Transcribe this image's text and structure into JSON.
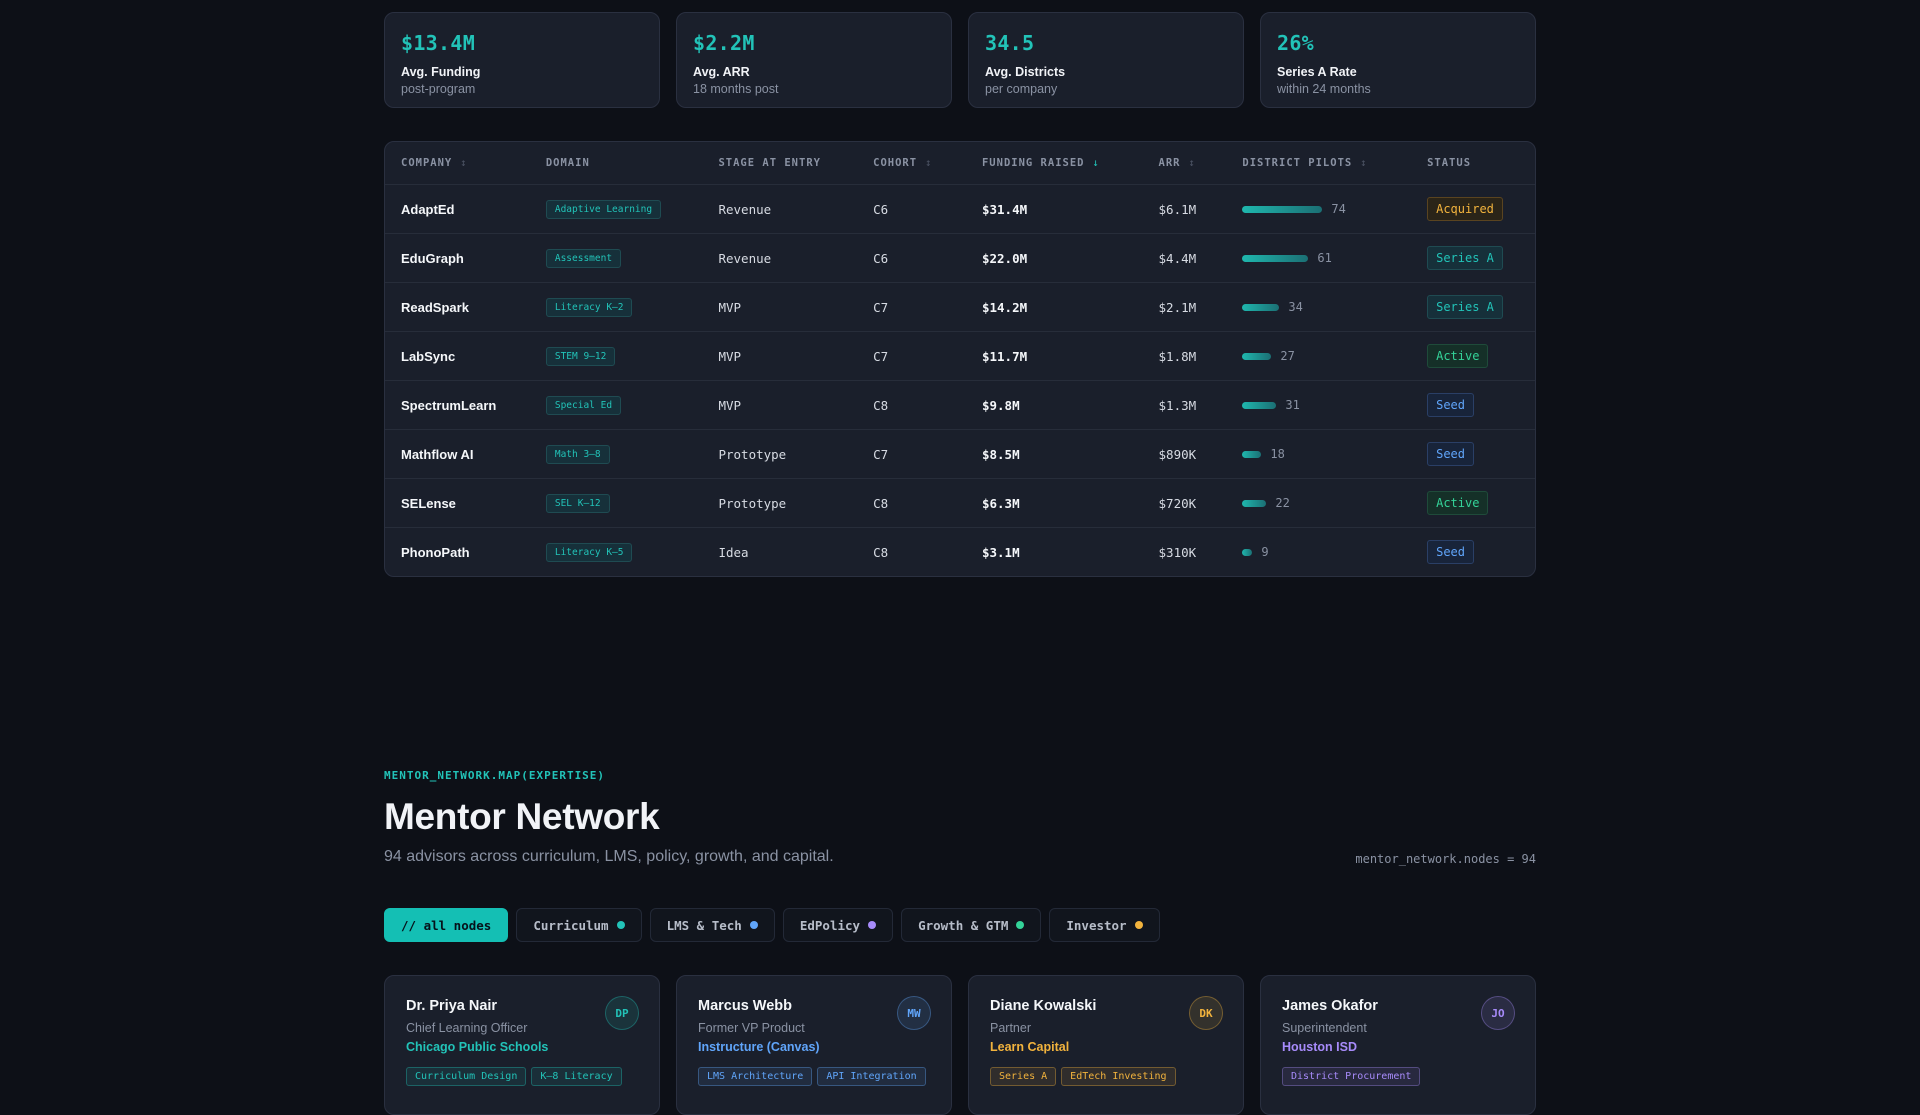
{
  "stats": [
    {
      "value": "$13.4M",
      "label": "Avg. Funding",
      "sub": "post-program"
    },
    {
      "value": "$2.2M",
      "label": "Avg. ARR",
      "sub": "18 months post"
    },
    {
      "value": "34.5",
      "label": "Avg. Districts",
      "sub": "per company"
    },
    {
      "value": "26%",
      "label": "Series A Rate",
      "sub": "within 24 months"
    }
  ],
  "table": {
    "columns": [
      {
        "label": "COMPANY",
        "sort": "↕",
        "active": false
      },
      {
        "label": "DOMAIN",
        "sort": "",
        "active": false
      },
      {
        "label": "STAGE AT ENTRY",
        "sort": "",
        "active": false
      },
      {
        "label": "COHORT",
        "sort": "↕",
        "active": false
      },
      {
        "label": "FUNDING RAISED",
        "sort": "↓",
        "active": true
      },
      {
        "label": "ARR",
        "sort": "↕",
        "active": false
      },
      {
        "label": "DISTRICT PILOTS",
        "sort": "↕",
        "active": false
      },
      {
        "label": "STATUS",
        "sort": "",
        "active": false
      }
    ],
    "rows": [
      {
        "company": "AdaptEd",
        "domain": "Adaptive Learning",
        "stage": "Revenue",
        "cohort": "C6",
        "funding": "$31.4M",
        "arr": "$6.1M",
        "pilots": 74,
        "status": "Acquired"
      },
      {
        "company": "EduGraph",
        "domain": "Assessment",
        "stage": "Revenue",
        "cohort": "C6",
        "funding": "$22.0M",
        "arr": "$4.4M",
        "pilots": 61,
        "status": "Series A"
      },
      {
        "company": "ReadSpark",
        "domain": "Literacy K–2",
        "stage": "MVP",
        "cohort": "C7",
        "funding": "$14.2M",
        "arr": "$2.1M",
        "pilots": 34,
        "status": "Series A"
      },
      {
        "company": "LabSync",
        "domain": "STEM 9–12",
        "stage": "MVP",
        "cohort": "C7",
        "funding": "$11.7M",
        "arr": "$1.8M",
        "pilots": 27,
        "status": "Active"
      },
      {
        "company": "SpectrumLearn",
        "domain": "Special Ed",
        "stage": "MVP",
        "cohort": "C8",
        "funding": "$9.8M",
        "arr": "$1.3M",
        "pilots": 31,
        "status": "Seed"
      },
      {
        "company": "Mathflow AI",
        "domain": "Math 3–8",
        "stage": "Prototype",
        "cohort": "C7",
        "funding": "$8.5M",
        "arr": "$890K",
        "pilots": 18,
        "status": "Seed"
      },
      {
        "company": "SELense",
        "domain": "SEL K–12",
        "stage": "Prototype",
        "cohort": "C8",
        "funding": "$6.3M",
        "arr": "$720K",
        "pilots": 22,
        "status": "Active"
      },
      {
        "company": "PhonoPath",
        "domain": "Literacy K–5",
        "stage": "Idea",
        "cohort": "C8",
        "funding": "$3.1M",
        "arr": "$310K",
        "pilots": 9,
        "status": "Seed"
      }
    ],
    "pilots_max": 74,
    "status_colors": {
      "Acquired": {
        "fg": "#f2b33d",
        "border": "#5a4420",
        "bg": "#2a2418"
      },
      "Series A": {
        "fg": "#22c3b8",
        "border": "#1f4b52",
        "bg": "#16303a"
      },
      "Active": {
        "fg": "#34d399",
        "border": "#1f4b3a",
        "bg": "#153028"
      },
      "Seed": {
        "fg": "#60a5fa",
        "border": "#2a3f66",
        "bg": "#18243a"
      }
    }
  },
  "mentor_section": {
    "eyebrow": "MENTOR_NETWORK.MAP(EXPERTISE)",
    "title": "Mentor Network",
    "subtitle": "94 advisors across curriculum, LMS, policy, growth, and capital.",
    "nodes_readout": "mentor_network.nodes = 94"
  },
  "filters": [
    {
      "label": "// all nodes",
      "active": true,
      "dot": ""
    },
    {
      "label": "Curriculum",
      "active": false,
      "dot": "#22c3b8"
    },
    {
      "label": "LMS & Tech",
      "active": false,
      "dot": "#60a5fa"
    },
    {
      "label": "EdPolicy",
      "active": false,
      "dot": "#a78bfa"
    },
    {
      "label": "Growth & GTM",
      "active": false,
      "dot": "#34d399"
    },
    {
      "label": "Investor",
      "active": false,
      "dot": "#f2b33d"
    }
  ],
  "mentors": [
    {
      "name": "Dr. Priya Nair",
      "role": "Chief Learning Officer",
      "org": "Chicago Public Schools",
      "initials": "DP",
      "color": "#22c3b8",
      "tags": [
        "Curriculum Design",
        "K–8 Literacy"
      ]
    },
    {
      "name": "Marcus Webb",
      "role": "Former VP Product",
      "org": "Instructure (Canvas)",
      "initials": "MW",
      "color": "#60a5fa",
      "tags": [
        "LMS Architecture",
        "API Integration"
      ]
    },
    {
      "name": "Diane Kowalski",
      "role": "Partner",
      "org": "Learn Capital",
      "initials": "DK",
      "color": "#f2b33d",
      "tags": [
        "Series A",
        "EdTech Investing"
      ]
    },
    {
      "name": "James Okafor",
      "role": "Superintendent",
      "org": "Houston ISD",
      "initials": "JO",
      "color": "#a78bfa",
      "tags": [
        "District Procurement"
      ]
    }
  ]
}
